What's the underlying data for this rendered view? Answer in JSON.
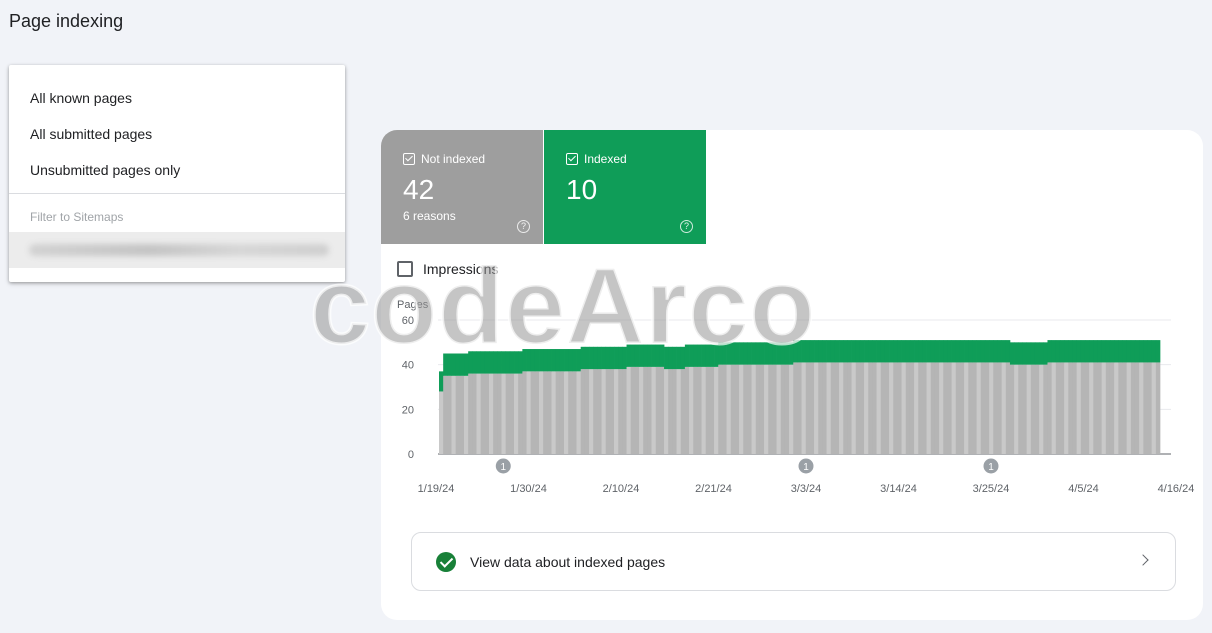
{
  "header": {
    "title": "Page indexing"
  },
  "dropdown": {
    "items": [
      "All known pages",
      "All submitted pages",
      "Unsubmitted pages only"
    ],
    "section_label": "Filter to Sitemaps"
  },
  "tiles": {
    "not_indexed": {
      "label": "Not indexed",
      "value": "42",
      "sub": "6 reasons",
      "color": "#9e9e9e"
    },
    "indexed": {
      "label": "Indexed",
      "value": "10",
      "color": "#0f9d58"
    }
  },
  "impressions": {
    "label": "Impressions",
    "checked": false
  },
  "chart_data": {
    "type": "bar",
    "stacked": true,
    "ylabel": "Pages",
    "ylim": [
      0,
      60
    ],
    "yticks": [
      0,
      20,
      40,
      60
    ],
    "xticks": [
      "1/19/24",
      "1/30/24",
      "2/10/24",
      "2/21/24",
      "3/3/24",
      "3/14/24",
      "3/25/24",
      "4/5/24",
      "4/16/24"
    ],
    "x_range": [
      "1/19/24",
      "4/16/24"
    ],
    "series": [
      {
        "color": "#b5b5b5",
        "values": [
          28,
          35,
          35,
          35,
          35,
          35,
          35,
          36,
          36,
          36,
          36,
          36,
          36,
          36,
          36,
          36,
          36,
          36,
          36,
          36,
          37,
          37,
          37,
          37,
          37,
          37,
          37,
          37,
          37,
          37,
          37,
          37,
          37,
          37,
          38,
          38,
          38,
          38,
          38,
          38,
          38,
          38,
          38,
          38,
          38,
          39,
          39,
          39,
          39,
          39,
          39,
          39,
          39,
          39,
          38,
          38,
          38,
          38,
          38,
          39,
          39,
          39,
          39,
          39,
          39,
          39,
          39,
          40,
          40,
          40,
          40,
          40,
          40,
          40,
          40,
          40,
          40,
          40,
          40,
          40,
          40,
          40,
          40,
          40,
          40,
          41,
          41,
          41,
          41,
          41,
          41,
          41,
          41,
          41,
          41,
          41,
          41,
          41,
          41,
          41,
          41,
          41,
          41,
          41,
          41,
          41,
          41,
          41,
          41,
          41,
          41,
          41,
          41,
          41,
          41,
          41,
          41,
          41,
          41,
          41,
          41,
          41,
          41,
          41,
          41,
          41,
          41,
          41,
          41,
          41,
          41,
          41,
          41,
          41,
          41,
          41,
          41,
          40,
          40,
          40,
          40,
          40,
          40,
          40,
          40,
          40,
          41,
          41,
          41,
          41,
          41,
          41,
          41,
          41,
          41,
          41,
          41,
          41,
          41,
          41,
          41,
          41,
          41,
          41,
          41,
          41,
          41,
          41,
          41,
          41,
          41,
          41,
          41
        ]
      },
      {
        "color": "#0f9d58",
        "values": [
          9,
          10,
          10,
          10,
          10,
          10,
          10,
          10,
          10,
          10,
          10,
          10,
          10,
          10,
          10,
          10,
          10,
          10,
          10,
          10,
          10,
          10,
          10,
          10,
          10,
          10,
          10,
          10,
          10,
          10,
          10,
          10,
          10,
          10,
          10,
          10,
          10,
          10,
          10,
          10,
          10,
          10,
          10,
          10,
          10,
          10,
          10,
          10,
          10,
          10,
          10,
          10,
          10,
          10,
          10,
          10,
          10,
          10,
          10,
          10,
          10,
          10,
          10,
          10,
          10,
          10,
          10,
          10,
          10,
          10,
          10,
          10,
          10,
          10,
          10,
          10,
          10,
          10,
          10,
          10,
          10,
          10,
          10,
          10,
          10,
          10,
          10,
          10,
          10,
          10,
          10,
          10,
          10,
          10,
          10,
          10,
          10,
          10,
          10,
          10,
          10,
          10,
          10,
          10,
          10,
          10,
          10,
          10,
          10,
          10,
          10,
          10,
          10,
          10,
          10,
          10,
          10,
          10,
          10,
          10,
          10,
          10,
          10,
          10,
          10,
          10,
          10,
          10,
          10,
          10,
          10,
          10,
          10,
          10,
          10,
          10,
          10,
          10,
          10,
          10,
          10,
          10,
          10,
          10,
          10,
          10,
          10,
          10,
          10,
          10,
          10,
          10,
          10,
          10,
          10,
          10,
          10,
          10,
          10,
          10,
          10,
          10,
          10,
          10,
          10,
          10,
          10,
          10,
          10,
          10,
          10,
          10,
          10
        ]
      }
    ],
    "annotations": [
      {
        "x": "1/27/24",
        "label": "1"
      },
      {
        "x": "3/3/24",
        "label": "1"
      },
      {
        "x": "3/25/24",
        "label": "1"
      }
    ],
    "grid": "horizontal"
  },
  "view_data": {
    "label": "View data about indexed pages"
  },
  "watermark": "codeArco"
}
